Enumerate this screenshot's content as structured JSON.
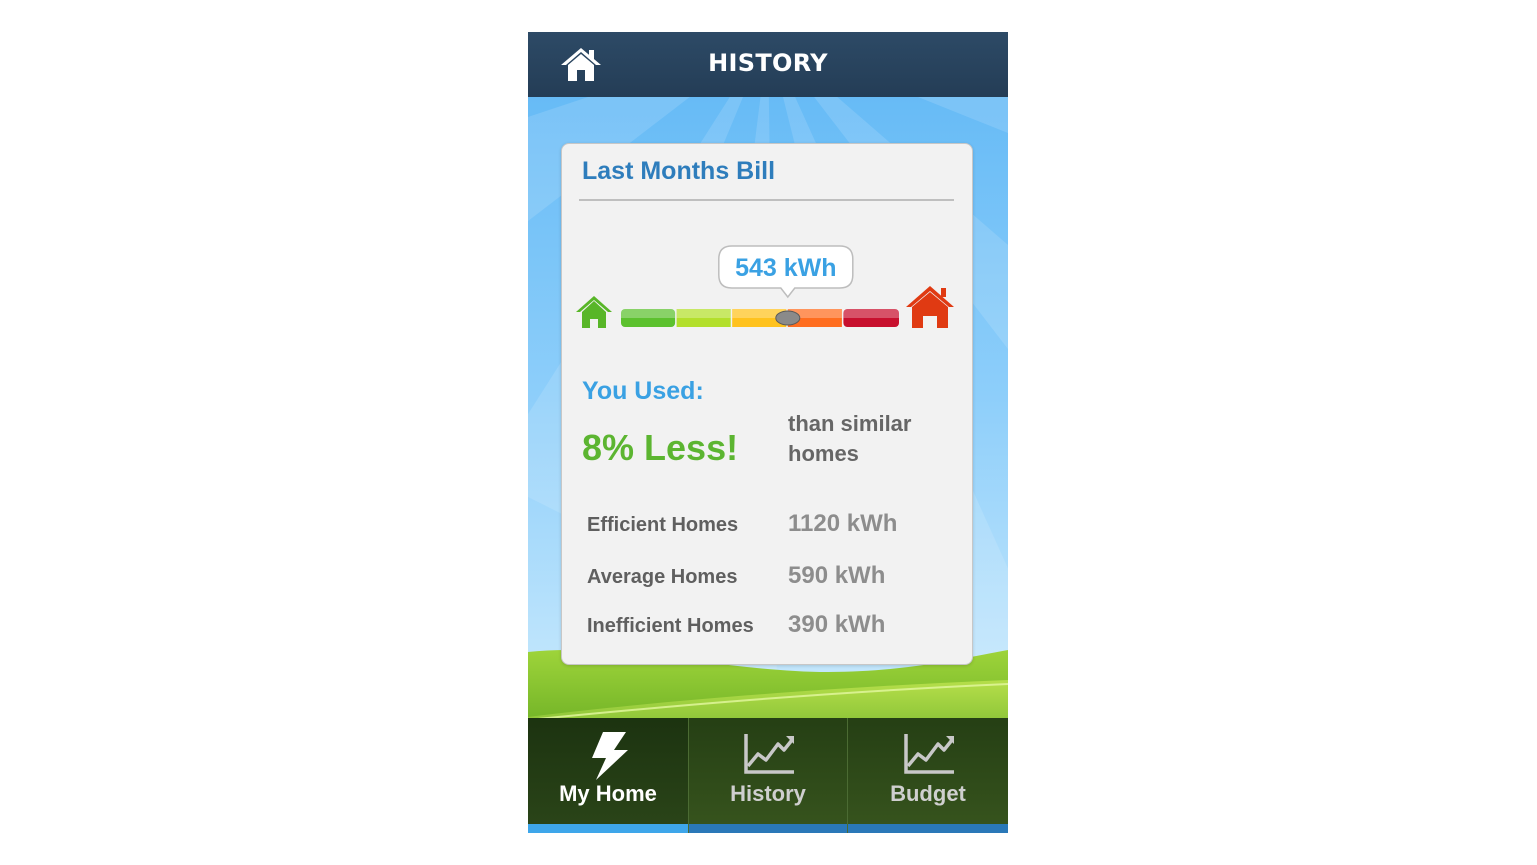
{
  "header": {
    "title": "HISTORY",
    "home_icon": "home-icon"
  },
  "card": {
    "title": "Last Months Bill",
    "gauge": {
      "value_label": "543 kWh",
      "position_fraction": 0.6,
      "low_icon": "green-house-icon",
      "high_icon": "red-house-icon",
      "segment_colors": [
        "#5cc12e",
        "#b3df2b",
        "#ffc21e",
        "#ff6d1f",
        "#c8102e"
      ]
    },
    "used_label": "You Used:",
    "difference": "8% Less!",
    "comparison_text": "than similar homes",
    "stats": [
      {
        "label": "Efficient Homes",
        "value": "1120 kWh"
      },
      {
        "label": "Average Homes",
        "value": "590 kWh"
      },
      {
        "label": "Inefficient Homes",
        "value": "390 kWh"
      }
    ]
  },
  "tabs": [
    {
      "label": "My Home",
      "icon": "lightning-icon",
      "active": true
    },
    {
      "label": "History",
      "icon": "chart-icon",
      "active": false
    },
    {
      "label": "Budget",
      "icon": "chart-icon",
      "active": false
    }
  ],
  "colors": {
    "header_bg": "#2d4a66",
    "title_blue": "#2e7dbc",
    "accent_blue": "#3aa1e3",
    "less_green": "#5cb531",
    "active_tab_indicator": "#3ea6ea",
    "inactive_tab_indicator": "#2a78b8"
  }
}
